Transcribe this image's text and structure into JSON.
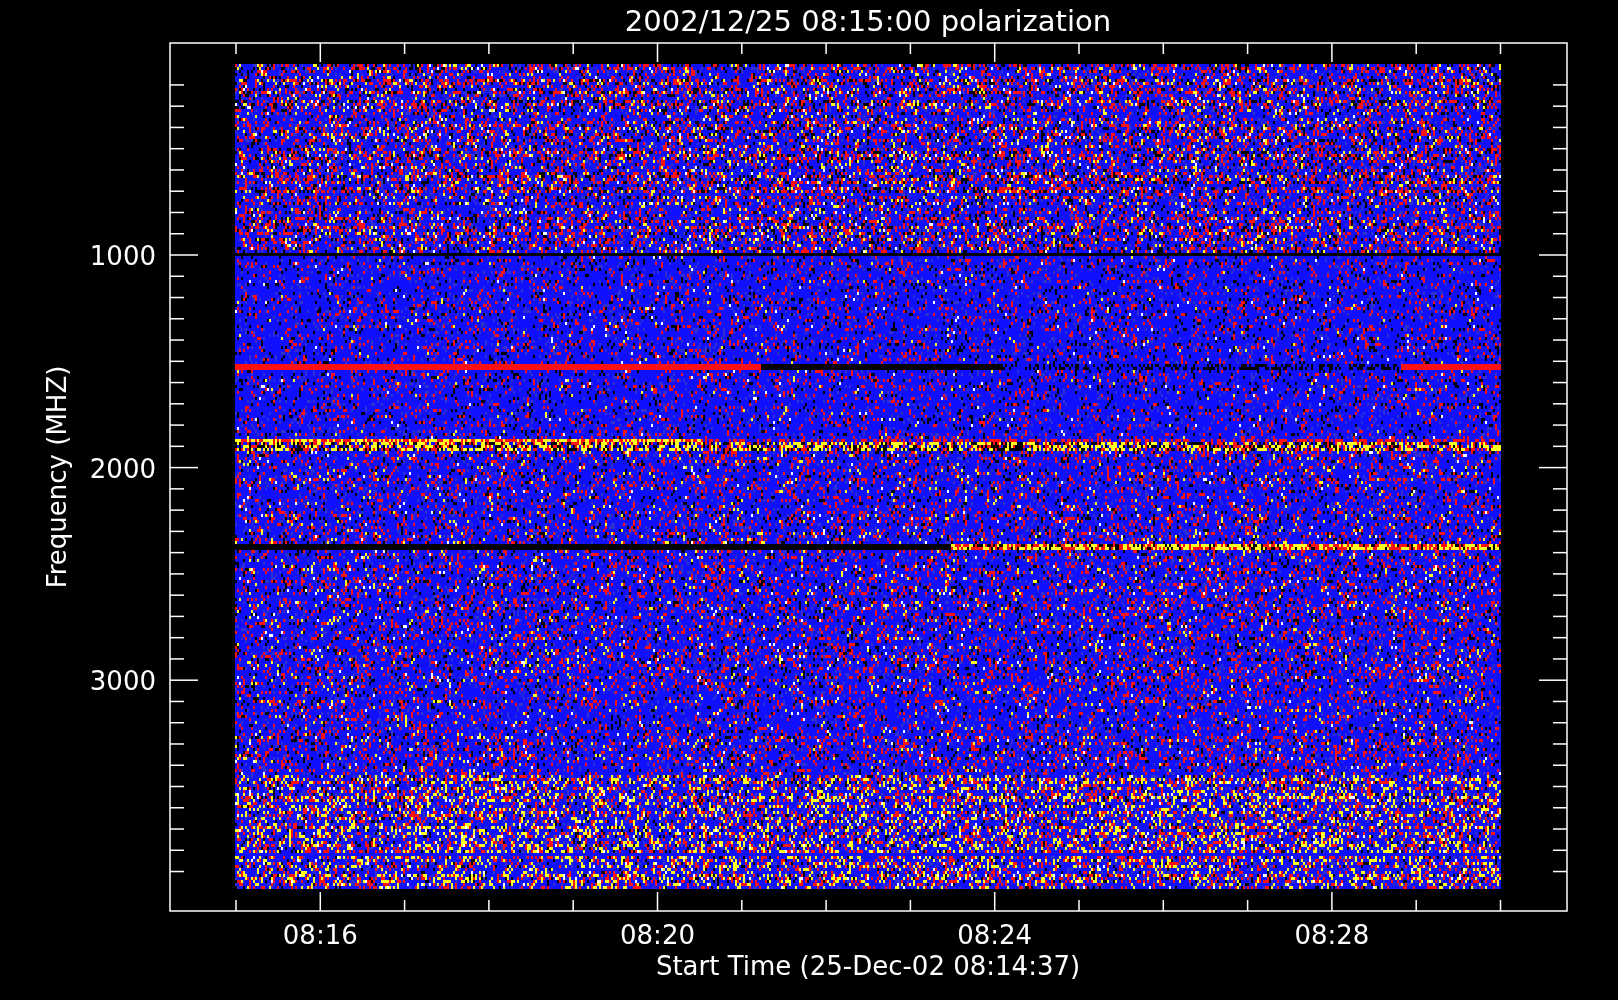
{
  "plot": {
    "title": "2002/12/25 08:15:00 polarization",
    "ylabel": "Frequency (MHZ)",
    "xlabel": "Start Time (25-Dec-02 08:14:37)",
    "yticks": [
      "1000",
      "2000",
      "3000"
    ],
    "xticks": [
      "08:16",
      "08:20",
      "08:24",
      "08:28"
    ]
  }
}
